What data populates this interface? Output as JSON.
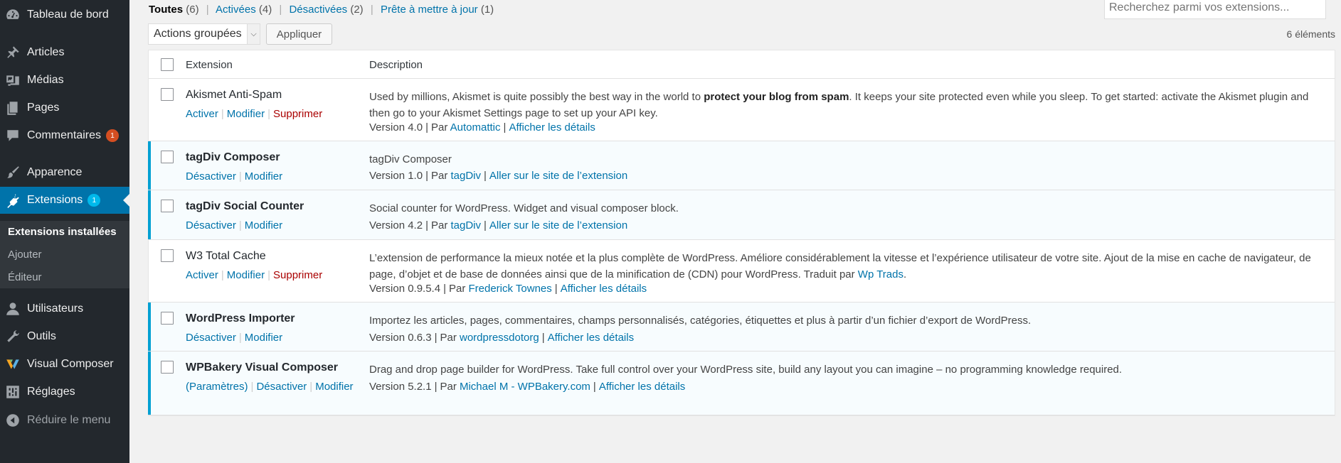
{
  "sidebar": {
    "items": [
      {
        "id": "dashboard",
        "label": "Tableau de bord",
        "icon": "dashboard-icon"
      },
      {
        "id": "articles",
        "label": "Articles",
        "icon": "pin-icon"
      },
      {
        "id": "medias",
        "label": "Médias",
        "icon": "media-icon"
      },
      {
        "id": "pages",
        "label": "Pages",
        "icon": "pages-icon"
      },
      {
        "id": "comments",
        "label": "Commentaires",
        "icon": "comment-icon",
        "badge": "1"
      },
      {
        "id": "appearance",
        "label": "Apparence",
        "icon": "brush-icon"
      },
      {
        "id": "extensions",
        "label": "Extensions",
        "icon": "plugin-icon",
        "badge": "1"
      },
      {
        "id": "users",
        "label": "Utilisateurs",
        "icon": "user-icon"
      },
      {
        "id": "tools",
        "label": "Outils",
        "icon": "wrench-icon"
      },
      {
        "id": "visual-composer",
        "label": "Visual Composer",
        "icon": "visual-composer-icon"
      },
      {
        "id": "settings",
        "label": "Réglages",
        "icon": "settings-icon"
      },
      {
        "id": "collapse",
        "label": "Réduire le menu",
        "icon": "collapse-icon"
      }
    ],
    "submenu": [
      {
        "label": "Extensions installées",
        "current": true
      },
      {
        "label": "Ajouter"
      },
      {
        "label": "Éditeur"
      }
    ]
  },
  "filters": {
    "all": {
      "label": "Toutes",
      "count": "(6)"
    },
    "active": {
      "label": "Activées",
      "count": "(4)"
    },
    "inactive": {
      "label": "Désactivées",
      "count": "(2)"
    },
    "upgrade": {
      "label": "Prête à mettre à jour",
      "count": "(1)"
    },
    "separator": "|"
  },
  "search": {
    "placeholder": "Recherchez parmi vos extensions..."
  },
  "bulk": {
    "select_label": "Actions groupées",
    "apply_label": "Appliquer"
  },
  "items_count": "6 éléments",
  "table": {
    "col_extension": "Extension",
    "col_description": "Description"
  },
  "plugins": [
    {
      "name": "Akismet Anti-Spam",
      "active": false,
      "actions": [
        "Activer",
        "Modifier",
        "Supprimer"
      ],
      "desc_before": "Used by millions, Akismet is quite possibly the best way in the world to ",
      "desc_strong": "protect your blog from spam",
      "desc_after": ". It keeps your site protected even while you sleep. To get started: activate the Akismet plugin and then go to your Akismet Settings page to set up your API key.",
      "version": "Version 4.0",
      "by": "Par",
      "author": "Automattic",
      "details": "Afficher les détails"
    },
    {
      "name": "tagDiv Composer",
      "active": true,
      "actions": [
        "Désactiver",
        "Modifier"
      ],
      "desc_before": "tagDiv Composer",
      "version": "Version 1.0",
      "by": "Par",
      "author": "tagDiv",
      "details": "Aller sur le site de l’extension"
    },
    {
      "name": "tagDiv Social Counter",
      "active": true,
      "actions": [
        "Désactiver",
        "Modifier"
      ],
      "desc_before": "Social counter for WordPress. Widget and visual composer block.",
      "version": "Version 4.2",
      "by": "Par",
      "author": "tagDiv",
      "details": "Aller sur le site de l’extension"
    },
    {
      "name": "W3 Total Cache",
      "active": false,
      "actions": [
        "Activer",
        "Modifier",
        "Supprimer"
      ],
      "desc_before": "L’extension de performance la mieux notée et la plus complète de WordPress. Améliore considérablement la vitesse et l’expérience utilisateur de votre site. Ajout de la mise en cache de navigateur, de page, d’objet et de base de données ainsi que de la minification de (CDN) pour WordPress. Traduit par ",
      "desc_link": "Wp Trads",
      "desc_after": ".",
      "version": "Version 0.9.5.4",
      "by": "Par",
      "author": "Frederick Townes",
      "details": "Afficher les détails"
    },
    {
      "name": "WordPress Importer",
      "active": true,
      "actions": [
        "Désactiver",
        "Modifier"
      ],
      "desc_before": "Importez les articles, pages, commentaires, champs personnalisés, catégories, étiquettes et plus à partir d’un fichier d’export de WordPress.",
      "version": "Version 0.6.3",
      "by": "Par",
      "author": "wordpressdotorg",
      "details": "Afficher les détails"
    },
    {
      "name": "WPBakery Visual Composer",
      "active": true,
      "actions": [
        "(Paramètres)",
        "Désactiver",
        "Modifier"
      ],
      "desc_before": "Drag and drop page builder for WordPress. Take full control over your WordPress site, build any layout you can imagine – no programming knowledge required.",
      "version": "Version 5.2.1",
      "by": "Par",
      "author": "Michael M - WPBakery.com",
      "details": "Afficher les détails"
    }
  ],
  "colors": {
    "sidebar_bg": "#23282d",
    "accent": "#0073aa",
    "active_border": "#00a0d2",
    "delete": "#aa0000"
  }
}
